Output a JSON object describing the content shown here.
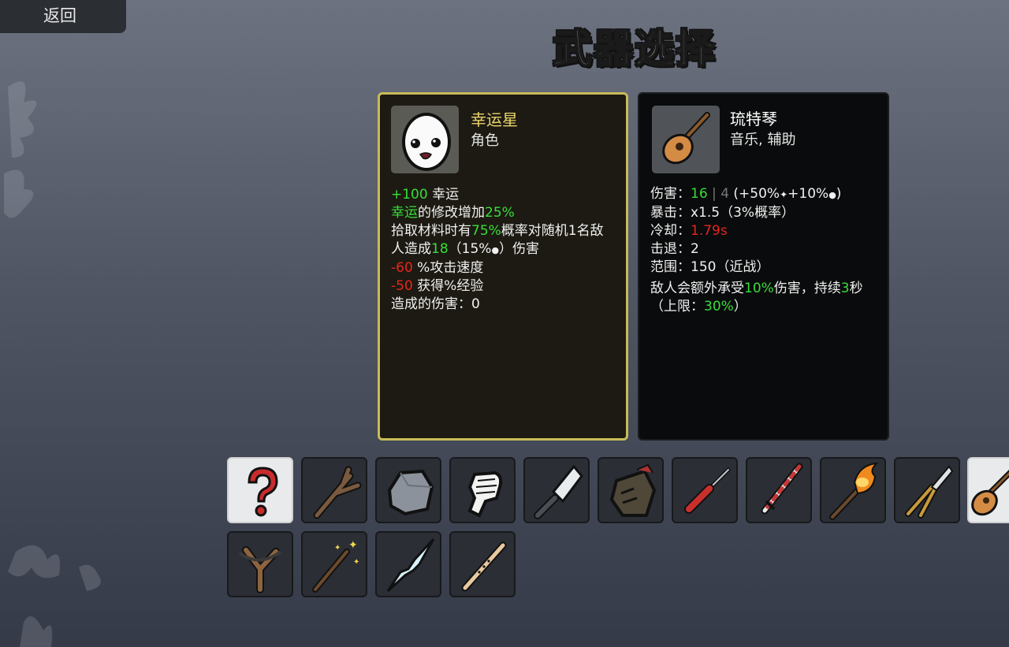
{
  "back_label": "返回",
  "title": "武器选择",
  "character": {
    "name": "幸运星",
    "type": "角色",
    "stats": [
      {
        "v": "+100",
        "vc": "g",
        "t": " 幸运"
      },
      {
        "k": "幸运",
        "t": "的修改增加",
        "p": "25%"
      },
      {
        "t": "拾取材料时有",
        "p": "75%",
        "t2": "概率对随机1名敌"
      },
      {
        "t": "人造成",
        "p": "18",
        "t2": "（15%",
        "ic": "🍀",
        "t3": "）伤害"
      },
      {
        "v": "-60",
        "vc": "r",
        "t": " %攻击速度"
      },
      {
        "v": "-50",
        "vc": "r",
        "t": " 获得%经验"
      },
      {
        "t": "造成的伤害：0"
      }
    ]
  },
  "weapon": {
    "name": "琉特琴",
    "tags": "音乐, 辅助",
    "lines": {
      "damage_label": "伤害：",
      "damage_value": "16",
      "damage_sep": " | ",
      "damage_base": "4",
      "damage_scaling": " (+50%",
      "damage_scaling2": "+10%",
      "damage_scaling3": ")",
      "crit": "暴击：x1.5（3%概率）",
      "cooldown_label": "冷却：",
      "cooldown_value": "1.79s",
      "knockback": "击退：2",
      "range": "范围：150（近战）",
      "effect_a": "敌人会额外承受",
      "effect_pct": "10%",
      "effect_b": "伤害，持续",
      "effect_sec": "3",
      "effect_c": "秒",
      "cap_a": "（上限：",
      "cap_value": "30%",
      "cap_b": "）"
    }
  },
  "weapon_grid": [
    {
      "name": "random",
      "icon": "question-icon"
    },
    {
      "name": "stick",
      "icon": "stick-icon"
    },
    {
      "name": "rock",
      "icon": "rock-icon"
    },
    {
      "name": "fist",
      "icon": "fist-icon"
    },
    {
      "name": "cleaver",
      "icon": "cleaver-icon"
    },
    {
      "name": "claw",
      "icon": "claw-icon"
    },
    {
      "name": "screwdriver",
      "icon": "screwdriver-icon"
    },
    {
      "name": "spear",
      "icon": "spear-icon"
    },
    {
      "name": "torch",
      "icon": "torch-icon"
    },
    {
      "name": "pruner",
      "icon": "pruner-icon"
    },
    {
      "name": "lute",
      "icon": "lute-icon"
    },
    {
      "name": "slingshot",
      "icon": "slingshot-icon"
    },
    {
      "name": "wand",
      "icon": "wand-icon"
    },
    {
      "name": "icicle",
      "icon": "icicle-icon"
    },
    {
      "name": "flute",
      "icon": "flute-icon"
    }
  ],
  "colors": {
    "positive": "#38de3a",
    "negative": "#e5261f",
    "character_border": "#c8ba59",
    "character_name": "#ead36b"
  }
}
